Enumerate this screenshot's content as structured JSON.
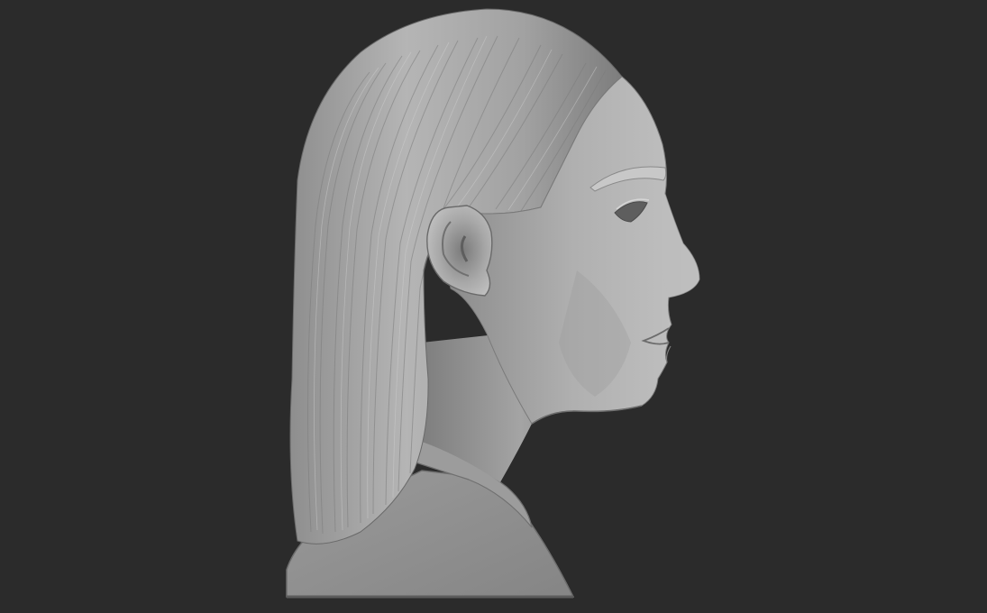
{
  "scene": {
    "background_color": "#2b2b2b",
    "material_color": "#a8a8a8",
    "subject": "sculpted-bust-profile",
    "facing": "right"
  }
}
